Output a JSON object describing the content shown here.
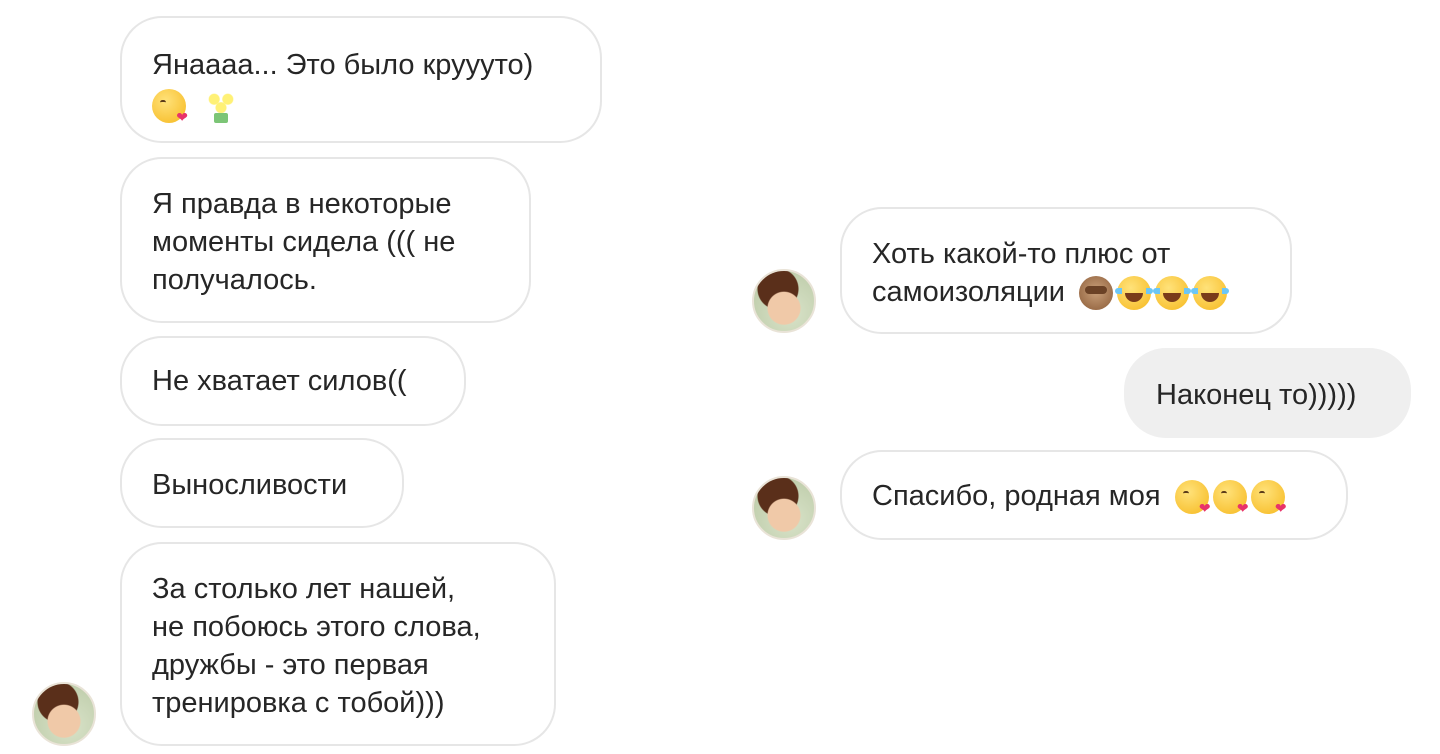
{
  "messages_left": [
    {
      "lines": [
        "Янаааа... Это было круууто)"
      ],
      "emoji_line": [
        "kiss",
        "bouquet"
      ]
    },
    {
      "lines": [
        "Я правда в некоторые",
        "моменты сидела ((( не",
        "получалось."
      ]
    },
    {
      "lines": [
        "Не хватает силов(("
      ]
    },
    {
      "lines": [
        "Выносливости"
      ]
    },
    {
      "lines": [
        "За столько лет нашей,",
        "не побоюсь этого слова,",
        "дружбы - это первая",
        "тренировка с тобой)))"
      ]
    }
  ],
  "messages_right": [
    {
      "lines": [
        "Хоть какой-то плюс от",
        "самоизоляции"
      ],
      "emojis": [
        "monkey",
        "laugh",
        "laugh",
        "laugh"
      ]
    },
    {
      "lines": [
        "Наконец то)))))"
      ],
      "sent": true
    },
    {
      "lines": [
        "Спасибо, родная моя"
      ],
      "emojis": [
        "kiss",
        "kiss",
        "kiss"
      ]
    }
  ]
}
